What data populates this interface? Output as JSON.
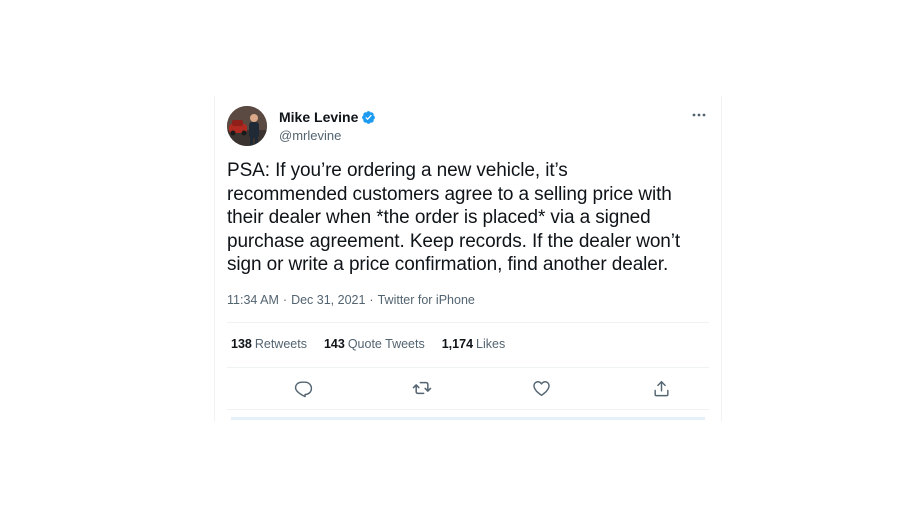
{
  "tweet": {
    "author": {
      "display_name": "Mike Levine",
      "handle": "@mrlevine",
      "verified": true,
      "avatar_icon": "avatar-photo"
    },
    "text": "PSA: If you’re ordering a new vehicle, it’s\nrecommended customers agree to a selling price with\ntheir dealer when *the order is placed* via a signed\npurchase agreement. Keep records. If the dealer won’t\nsign or write a price confirmation, find another dealer.",
    "meta": {
      "time": "11:34 AM",
      "separator": "·",
      "date": "Dec 31, 2021",
      "source": "Twitter for iPhone"
    },
    "stats": {
      "retweets_count": "138",
      "retweets_label": "Retweets",
      "quote_tweets_count": "143",
      "quote_tweets_label": "Quote Tweets",
      "likes_count": "1,174",
      "likes_label": "Likes"
    },
    "actions": [
      "reply-icon",
      "retweet-icon",
      "like-icon",
      "share-icon"
    ],
    "colors": {
      "text": "#0f1419",
      "secondary": "#536471",
      "verified": "#1d9bf0",
      "divider": "#eff3f4"
    }
  }
}
